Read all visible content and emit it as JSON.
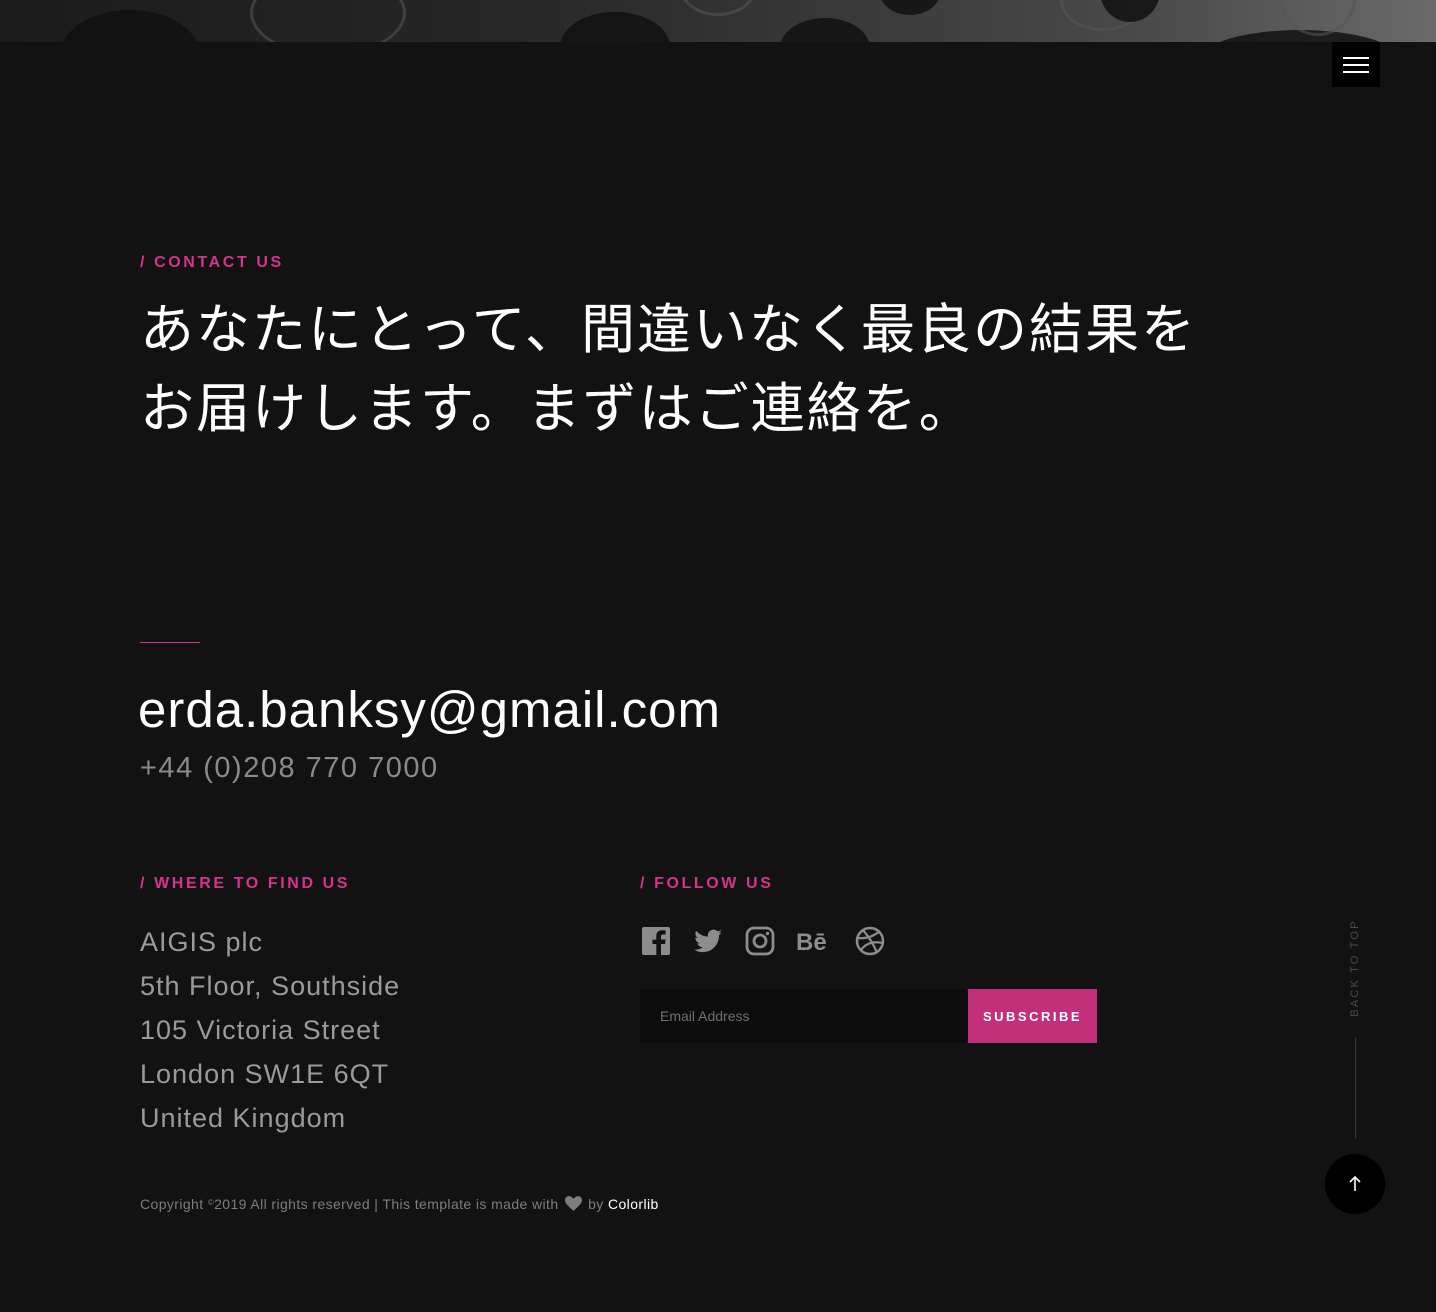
{
  "header": {
    "menu_icon": "hamburger-menu-icon"
  },
  "contact": {
    "eyebrow": "/ Contact Us",
    "headline_line1": "あなたにとって、間違いなく最良の結果を",
    "headline_line2": "お届けします。まずはご連絡を。",
    "email": "erda.banksy@gmail.com",
    "phone": "+44 (0)208 770 7000"
  },
  "where": {
    "eyebrow": "/ Where to find us",
    "address_lines": [
      "AIGIS plc",
      "5th Floor, Southside",
      "105 Victoria Street",
      "London SW1E 6QT",
      "United Kingdom"
    ]
  },
  "follow": {
    "eyebrow": "/ Follow us",
    "icons": [
      "facebook-icon",
      "twitter-icon",
      "instagram-icon",
      "behance-icon",
      "dribbble-icon"
    ]
  },
  "subscribe": {
    "placeholder": "Email Address",
    "button_label": "SUBSCRIBE"
  },
  "back_to_top": {
    "label": "BACK TO TOP",
    "icon": "arrow-up-icon"
  },
  "footer": {
    "copyright_prefix": "Copyright ",
    "copyright_symbol": "©",
    "copyright_text": "2019 All rights reserved | This template is made with",
    "by_text": " by ",
    "link_text": "Colorlib",
    "heart_icon": "heart-icon"
  },
  "colors": {
    "accent": "#d6338c",
    "button": "#c2307c",
    "background": "#121212"
  }
}
